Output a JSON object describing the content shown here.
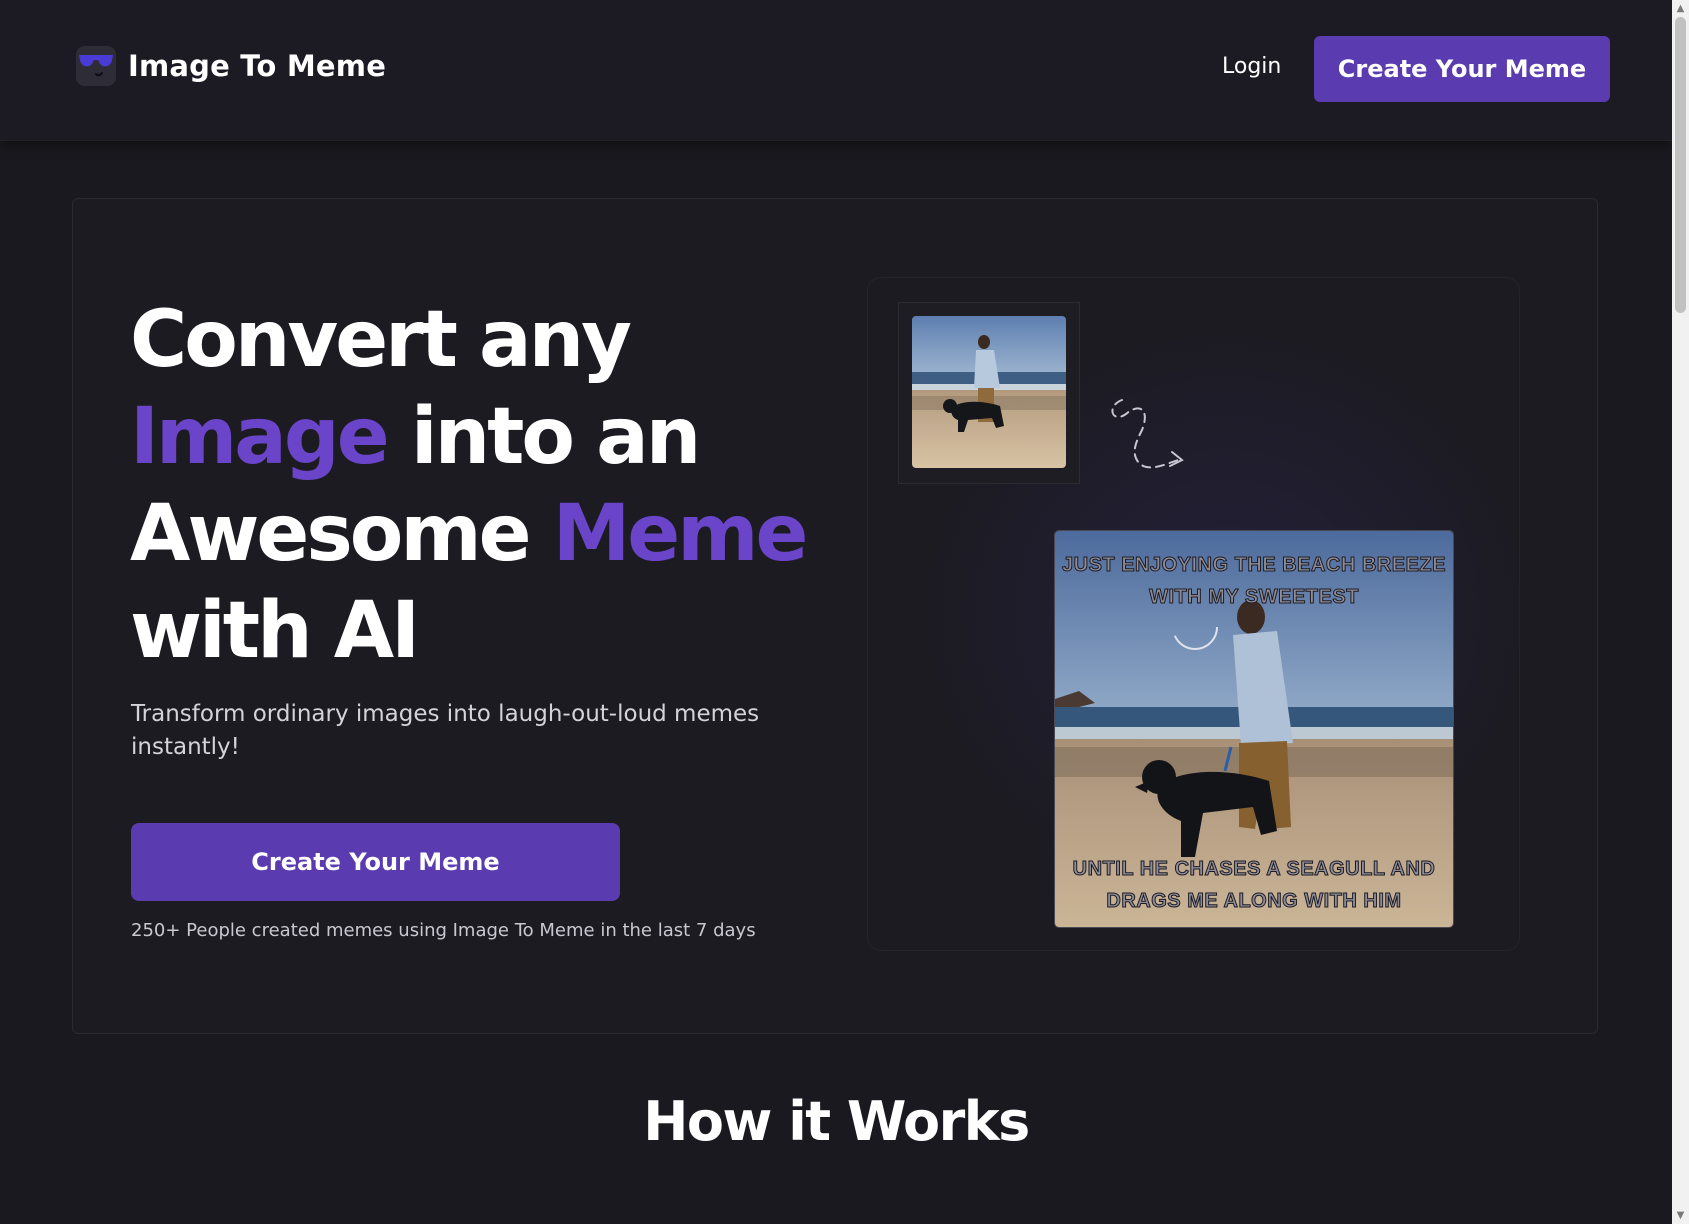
{
  "header": {
    "brand_name": "Image To Meme",
    "login_label": "Login",
    "cta_label": "Create Your Meme"
  },
  "hero": {
    "headline": {
      "line1": "Convert any",
      "line2_accent": "Image",
      "line2_rest": "into an",
      "line3_start": "Awesome",
      "line3_accent": "Meme",
      "line4": "with AI"
    },
    "subtitle": "Transform ordinary images into laugh-out-loud memes instantly!",
    "cta_label": "Create Your Meme",
    "social_proof": "250+ People created memes using Image To Meme in the last 7 days"
  },
  "demo": {
    "meme_top_text": "JUST ENJOYING THE BEACH BREEZE WITH MY SWEETEST",
    "meme_bottom_text": "UNTIL HE CHASES A SEAGULL AND DRAGS ME ALONG WITH HIM"
  },
  "how_it_works": {
    "title": "How it Works"
  },
  "icons": {
    "logo": "sunglasses-face-icon",
    "arrow": "dashed-curved-arrow-icon"
  },
  "colors": {
    "accent": "#6b45c9",
    "button": "#5b3cb0",
    "background": "#1a191f"
  }
}
